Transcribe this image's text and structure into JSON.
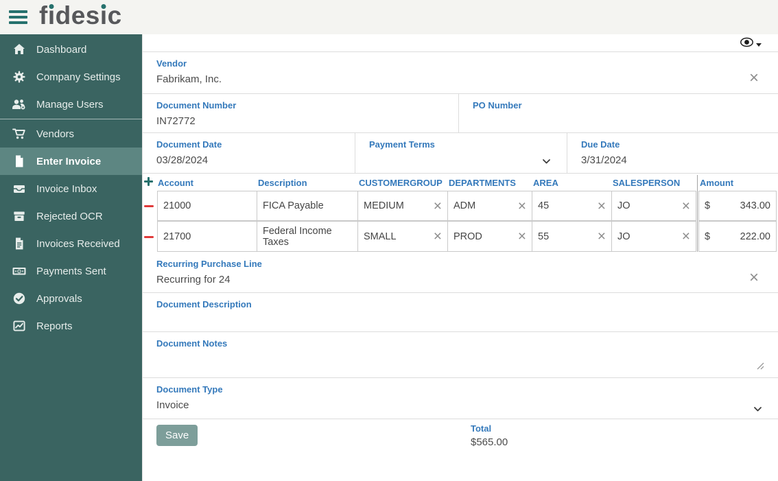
{
  "brand": "fidesic",
  "brand_parts": [
    "f",
    "i",
    "des",
    "i",
    "c"
  ],
  "sidebar": {
    "items": [
      {
        "label": "Dashboard",
        "icon": "home-icon"
      },
      {
        "label": "Company Settings",
        "icon": "gear-icon"
      },
      {
        "label": "Manage Users",
        "icon": "users-icon"
      },
      {
        "label": "Vendors",
        "icon": "cart-icon"
      },
      {
        "label": "Enter Invoice",
        "icon": "invoice-icon",
        "active": true
      },
      {
        "label": "Invoice Inbox",
        "icon": "inbox-icon"
      },
      {
        "label": "Rejected OCR",
        "icon": "archive-box-icon"
      },
      {
        "label": "Invoices Received",
        "icon": "document-icon"
      },
      {
        "label": "Payments Sent",
        "icon": "banknote-icon"
      },
      {
        "label": "Approvals",
        "icon": "check-circle-icon"
      },
      {
        "label": "Reports",
        "icon": "chart-icon"
      }
    ]
  },
  "form": {
    "vendor": {
      "label": "Vendor",
      "value": "Fabrikam, Inc."
    },
    "document_number": {
      "label": "Document Number",
      "value": "IN72772"
    },
    "po_number": {
      "label": "PO Number",
      "value": ""
    },
    "document_date": {
      "label": "Document Date",
      "value": "03/28/2024"
    },
    "payment_terms": {
      "label": "Payment Terms",
      "value": ""
    },
    "due_date": {
      "label": "Due Date",
      "value": "3/31/2024"
    },
    "recurring_purchase_line": {
      "label": "Recurring Purchase Line",
      "value": "Recurring for 24"
    },
    "document_description": {
      "label": "Document Description",
      "value": ""
    },
    "document_notes": {
      "label": "Document Notes",
      "value": ""
    },
    "document_type": {
      "label": "Document Type",
      "value": "Invoice"
    },
    "save_label": "Save",
    "total": {
      "label": "Total",
      "value": "$565.00"
    }
  },
  "line_items": {
    "columns": [
      "Account",
      "Description",
      "CUSTOMERGROUP",
      "DEPARTMENTS",
      "AREA",
      "SALESPERSON",
      "Amount"
    ],
    "rows": [
      {
        "account": "21000",
        "description": "FICA Payable",
        "customergroup": "MEDIUM",
        "departments": "ADM",
        "area": "45",
        "salesperson": "JO",
        "currency": "$",
        "amount": "343.00"
      },
      {
        "account": "21700",
        "description": "Federal Income Taxes",
        "customergroup": "SMALL",
        "departments": "PROD",
        "area": "55",
        "salesperson": "JO",
        "currency": "$",
        "amount": "222.00"
      }
    ]
  },
  "colors": {
    "accent_teal": "#26716d",
    "sidebar_bg": "#3a6461",
    "sidebar_active_bg": "#5d8682",
    "label_blue": "#3479bb",
    "remove_red": "#e03a3a",
    "save_button_bg": "#7d9e9a"
  }
}
